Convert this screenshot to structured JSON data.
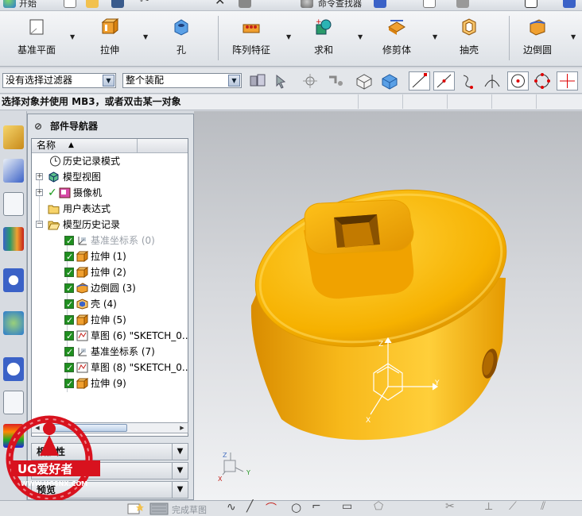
{
  "top_menu": {
    "start_label": "开始",
    "command_finder_label": "命令查找器"
  },
  "ribbon": {
    "buttons": [
      {
        "label": "基准平面",
        "icon": "datum-plane-icon"
      },
      {
        "label": "拉伸",
        "icon": "extrude-icon"
      },
      {
        "label": "孔",
        "icon": "hole-icon"
      },
      {
        "label": "阵列特征",
        "icon": "pattern-feature-icon"
      },
      {
        "label": "求和",
        "icon": "unite-icon"
      },
      {
        "label": "修剪体",
        "icon": "trim-body-icon"
      },
      {
        "label": "抽壳",
        "icon": "shell-icon"
      },
      {
        "label": "边倒圆",
        "icon": "edge-blend-icon"
      }
    ]
  },
  "filterbar": {
    "type_filter": "没有选择过滤器",
    "scope_filter": "整个装配"
  },
  "prompt": "选择对象并使用 MB3，或者双击某一对象",
  "navigator": {
    "title": "部件导航器",
    "column_name": "名称",
    "items": [
      {
        "label": "历史记录模式",
        "icon": "clock-icon"
      },
      {
        "label": "模型视图",
        "icon": "model-views-icon"
      },
      {
        "label": "摄像机",
        "icon": "camera-icon"
      },
      {
        "label": "用户表达式",
        "icon": "folder-icon"
      },
      {
        "label": "模型历史记录",
        "icon": "folder-open-icon"
      },
      {
        "label": "基准坐标系 (0)",
        "icon": "datum-csys-icon"
      },
      {
        "label": "拉伸 (1)",
        "icon": "extrude-icon"
      },
      {
        "label": "拉伸 (2)",
        "icon": "extrude-icon"
      },
      {
        "label": "边倒圆 (3)",
        "icon": "edge-blend-icon"
      },
      {
        "label": "壳 (4)",
        "icon": "shell-icon"
      },
      {
        "label": "拉伸 (5)",
        "icon": "extrude-icon"
      },
      {
        "label": "草图 (6) \"SKETCH_0...",
        "icon": "sketch-icon"
      },
      {
        "label": "基准坐标系 (7)",
        "icon": "datum-csys-icon"
      },
      {
        "label": "草图 (8) \"SKETCH_0...",
        "icon": "sketch-icon"
      },
      {
        "label": "拉伸 (9)",
        "icon": "extrude-icon"
      }
    ],
    "sections": [
      {
        "label": "相依性"
      },
      {
        "label": "细节"
      },
      {
        "label": "预览"
      }
    ]
  },
  "viewport": {
    "csys_labels": {
      "x": "X",
      "y": "Y",
      "z": "Z"
    },
    "part_color": "#f5a400"
  },
  "bottombar": {
    "finish_sketch_label": "完成草图"
  },
  "watermark": {
    "brand": "UG爱好者",
    "url": "WWW.UGSNX.COM"
  }
}
